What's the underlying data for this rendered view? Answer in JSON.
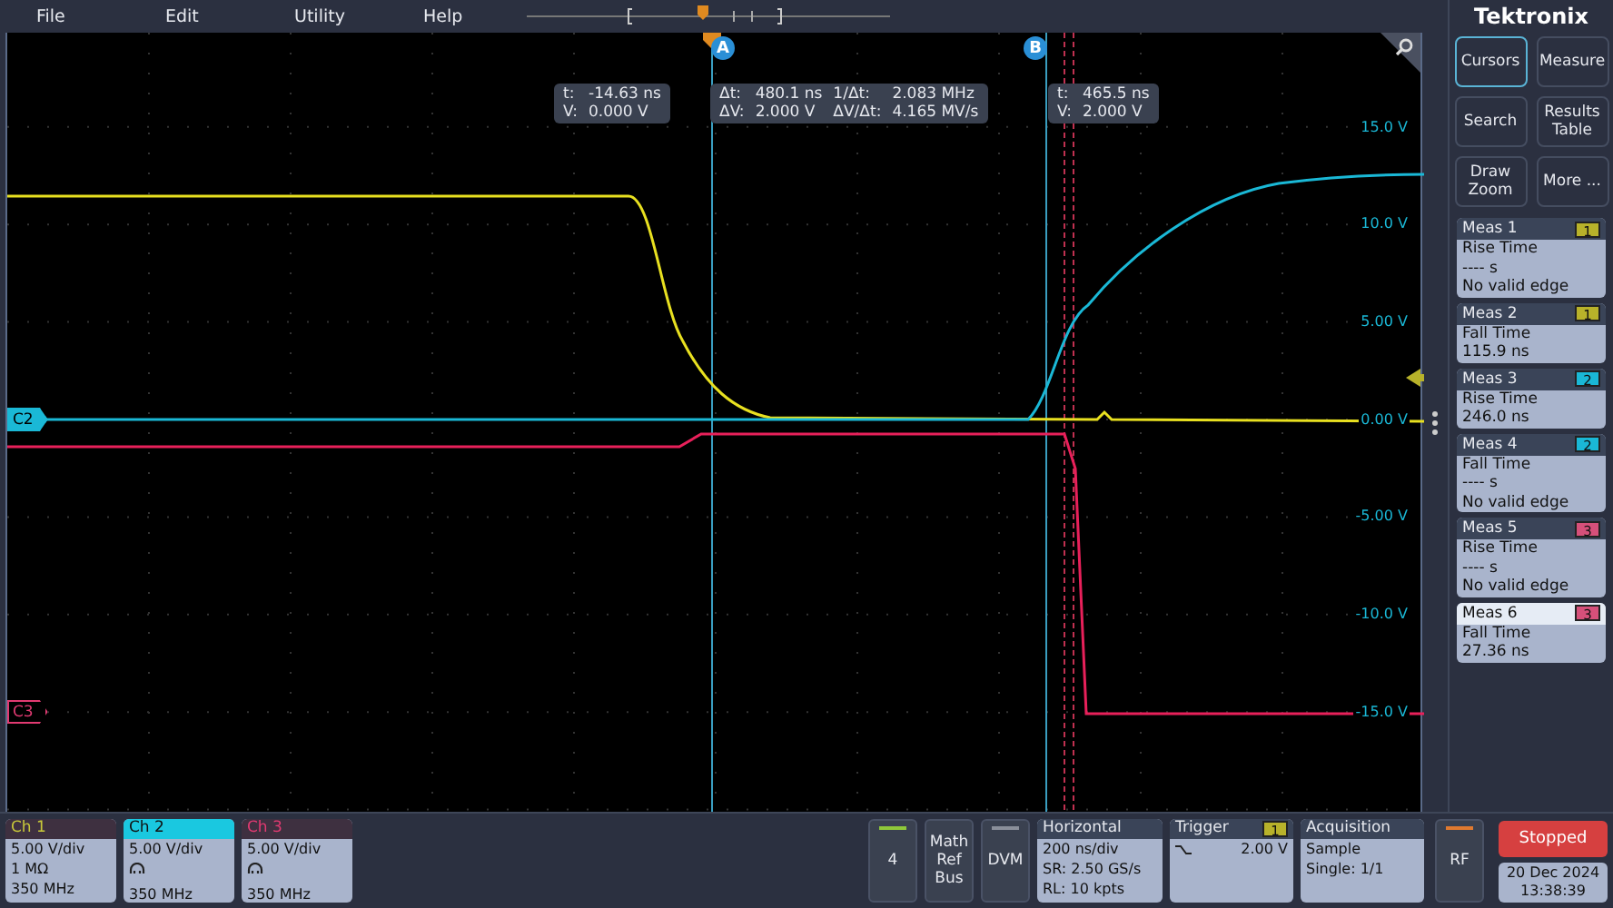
{
  "menu": [
    "File",
    "Edit",
    "Utility",
    "Help"
  ],
  "brand": "Tektronix",
  "cursors": [
    {
      "label": "A"
    },
    {
      "label": "B"
    }
  ],
  "readouts": [
    {
      "cells": [
        {
          "label": "t:",
          "value": "-14.63 ns"
        },
        {
          "label": "V:",
          "value": "0.000 V"
        }
      ]
    },
    {
      "cells": [
        {
          "label": "Δt:",
          "value": "480.1 ns"
        },
        {
          "label": "1/Δt:",
          "value": "2.083 MHz"
        },
        {
          "label": "ΔV:",
          "value": "2.000 V"
        },
        {
          "label": "ΔV/Δt:",
          "value": "4.165 MV/s"
        }
      ]
    },
    {
      "cells": [
        {
          "label": "t:",
          "value": "465.5 ns"
        },
        {
          "label": "V:",
          "value": "2.000 V"
        }
      ]
    }
  ],
  "axis_labels": [
    "15.0 V",
    "10.0 V",
    "5.00 V",
    "0.00 V",
    "-5.00 V",
    "-10.0 V",
    "-15.0 V"
  ],
  "channel_markers": [
    {
      "label": "C2",
      "color": "#1ab8d6",
      "selected": true
    },
    {
      "label": "C3",
      "color": "#e23a72",
      "selected": false
    }
  ],
  "side_buttons": [
    {
      "label": "Cursors",
      "selected": true
    },
    {
      "label": "Measure",
      "selected": false
    },
    {
      "label": "Search",
      "selected": false
    },
    {
      "label": "Results Table",
      "selected": false
    },
    {
      "label": "Draw Zoom",
      "selected": false
    },
    {
      "label": "More ...",
      "selected": false
    }
  ],
  "measurements": [
    {
      "title": "Meas 1",
      "source": "1",
      "color": "#b8b22a",
      "type": "Rise Time",
      "value": "---- s",
      "note": "No valid edge",
      "selected": false
    },
    {
      "title": "Meas 2",
      "source": "1",
      "color": "#b8b22a",
      "type": "Fall Time",
      "value": "115.9 ns",
      "selected": false
    },
    {
      "title": "Meas 3",
      "source": "2",
      "color": "#1ab8d6",
      "type": "Rise Time",
      "value": "246.0 ns",
      "selected": false
    },
    {
      "title": "Meas 4",
      "source": "2",
      "color": "#1ab8d6",
      "type": "Fall Time",
      "value": "---- s",
      "note": "No valid edge",
      "selected": false
    },
    {
      "title": "Meas 5",
      "source": "3",
      "color": "#d6507a",
      "type": "Rise Time",
      "value": "---- s",
      "note": "No valid edge",
      "selected": false
    },
    {
      "title": "Meas 6",
      "source": "3",
      "color": "#d6507a",
      "type": "Fall Time",
      "value": "27.36 ns",
      "selected": true
    }
  ],
  "channels": [
    {
      "title": "Ch 1",
      "color": "#c8c83a",
      "selected": false,
      "lines": [
        {
          "kind": "text",
          "text": "5.00 V/div"
        },
        {
          "kind": "text",
          "text": "1 MΩ"
        },
        {
          "kind": "text",
          "text": "350 MHz"
        }
      ]
    },
    {
      "title": "Ch 2",
      "color": "#1ac8e0",
      "selected": true,
      "lines": [
        {
          "kind": "text",
          "text": "5.00 V/div"
        },
        {
          "kind": "probe"
        },
        {
          "kind": "text",
          "text": "350 MHz"
        }
      ]
    },
    {
      "title": "Ch 3",
      "color": "#e23a72",
      "selected": false,
      "lines": [
        {
          "kind": "text",
          "text": "5.00 V/div"
        },
        {
          "kind": "probe"
        },
        {
          "kind": "text",
          "text": "350 MHz"
        }
      ]
    }
  ],
  "tools": [
    {
      "lines": [
        "4"
      ],
      "color": "#8fc83a"
    },
    {
      "lines": [
        "Math",
        "Ref",
        "Bus"
      ]
    },
    {
      "lines": [
        "DVM"
      ],
      "color": "#8a8f9a"
    }
  ],
  "horizontal": {
    "title": "Horizontal",
    "lines": [
      "200 ns/div",
      "SR: 2.50 GS/s",
      "RL: 10 kpts"
    ]
  },
  "trigger": {
    "title": "Trigger",
    "source": "1",
    "color": "#b8b22a",
    "threshold": "2.00 V"
  },
  "acquisition": {
    "title": "Acquisition",
    "lines": [
      "Sample",
      "Single: 1/1"
    ]
  },
  "rf": {
    "lines": [
      "RF"
    ],
    "color": "#e07a30"
  },
  "run_state": {
    "label": "Stopped",
    "running": false
  },
  "date": "20 Dec 2024",
  "time": "13:38:39"
}
